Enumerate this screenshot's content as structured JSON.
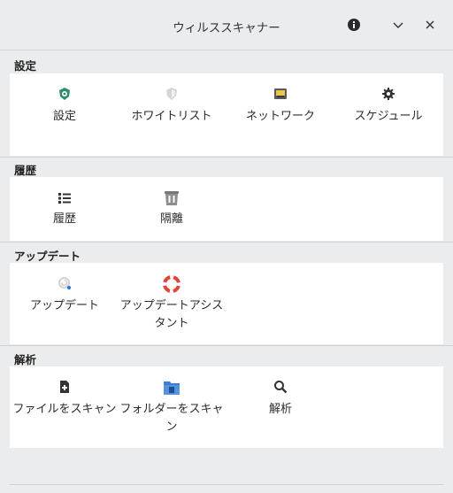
{
  "window": {
    "title": "ウィルススキャナー"
  },
  "titlebar_buttons": [
    {
      "icon": "info-icon"
    },
    {
      "icon": "chevron-down-icon"
    },
    {
      "icon": "close-icon"
    }
  ],
  "sections": [
    {
      "label": "設定",
      "items": [
        {
          "label": "設定",
          "icon": "shield-gear-icon"
        },
        {
          "label": "ホワイトリスト",
          "icon": "whitelist-shield-icon"
        },
        {
          "label": "ネットワーク",
          "icon": "network-port-icon"
        },
        {
          "label": "スケジュール",
          "icon": "gear-icon"
        }
      ]
    },
    {
      "label": "履歴",
      "items": [
        {
          "label": "履歴",
          "icon": "list-icon"
        },
        {
          "label": "隔離",
          "icon": "trash-bin-icon"
        }
      ]
    },
    {
      "label": "アップデート",
      "items": [
        {
          "label": "アップデート",
          "icon": "update-icon"
        },
        {
          "label": "アップデートアシスタント",
          "icon": "lifebuoy-icon"
        }
      ]
    },
    {
      "label": "解析",
      "items": [
        {
          "label": "ファイルをスキャン",
          "icon": "file-add-icon"
        },
        {
          "label": "フォルダーをスキャン",
          "icon": "folder-icon"
        },
        {
          "label": "解析",
          "icon": "search-icon"
        }
      ]
    }
  ],
  "colors": {
    "accent_green": "#2e8b6e",
    "lifebuoy_red": "#e0453a",
    "folder_blue": "#3d7fd4",
    "update_dot_blue": "#2f6fe0"
  }
}
